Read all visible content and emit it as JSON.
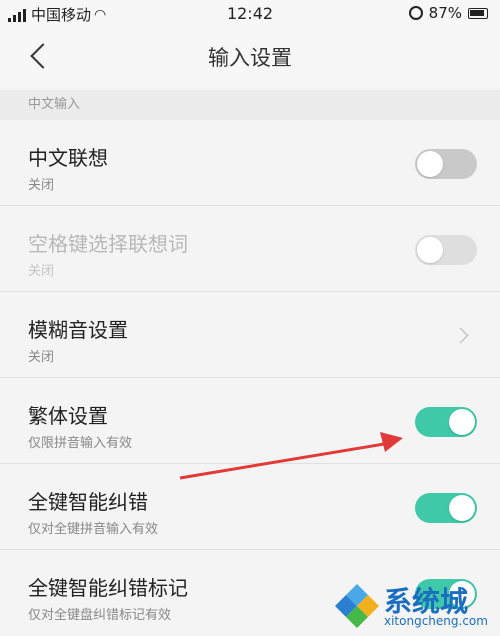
{
  "status_bar": {
    "carrier": "中国移动",
    "time": "12:42",
    "battery": "87%"
  },
  "header": {
    "title": "输入设置"
  },
  "section": {
    "label": "中文输入"
  },
  "rows": [
    {
      "title": "中文联想",
      "subtitle": "关闭",
      "control": "toggle",
      "on": false,
      "disabled": false
    },
    {
      "title": "空格键选择联想词",
      "subtitle": "关闭",
      "control": "toggle",
      "on": false,
      "disabled": true
    },
    {
      "title": "模糊音设置",
      "subtitle": "关闭",
      "control": "chevron",
      "disabled": false
    },
    {
      "title": "繁体设置",
      "subtitle": "仅限拼音输入有效",
      "control": "toggle",
      "on": true,
      "disabled": false
    },
    {
      "title": "全键智能纠错",
      "subtitle": "仅对全键拼音输入有效",
      "control": "toggle",
      "on": true,
      "disabled": false
    },
    {
      "title": "全键智能纠错标记",
      "subtitle": "仅对全键盘纠错标记有效",
      "control": "toggle",
      "on": true,
      "disabled": false
    }
  ],
  "watermark": {
    "brand": "系统城",
    "url": "xitongcheng.com"
  },
  "colors": {
    "toggle_on": "#3fc9a8",
    "toggle_off": "#c9c9c9",
    "annotation_arrow": "#e03a3a"
  }
}
